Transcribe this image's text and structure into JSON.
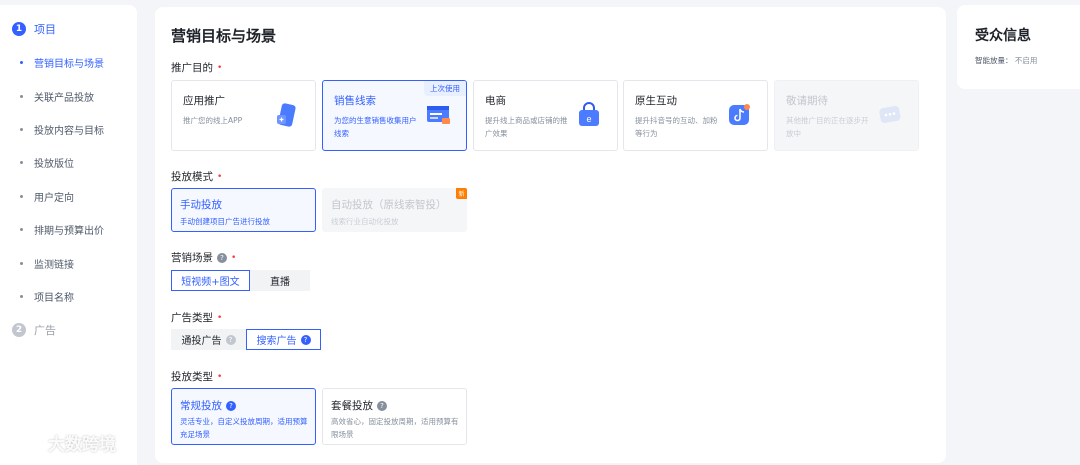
{
  "sidebar": {
    "step1": {
      "num": "1",
      "label": "项目"
    },
    "items": [
      {
        "label": "营销目标与场景"
      },
      {
        "label": "关联产品投放"
      },
      {
        "label": "投放内容与目标"
      },
      {
        "label": "投放版位"
      },
      {
        "label": "用户定向"
      },
      {
        "label": "排期与预算出价"
      },
      {
        "label": "监测链接"
      },
      {
        "label": "项目名称"
      }
    ],
    "step2": {
      "num": "2",
      "label": "广告"
    }
  },
  "main": {
    "title": "营销目标与场景",
    "purpose": {
      "label": "推广目的",
      "cards": [
        {
          "title": "应用推广",
          "desc": "推广您的线上APP"
        },
        {
          "title": "销售线索",
          "desc": "为您的生意销售收集用户线索",
          "badge": "上次使用"
        },
        {
          "title": "电商",
          "desc": "提升线上商品或店铺的推广效果"
        },
        {
          "title": "原生互动",
          "desc": "提升抖音号的互动、加粉等行为"
        },
        {
          "title": "敬请期待",
          "desc": "其他推广目的正在逐步开放中"
        }
      ]
    },
    "mode": {
      "label": "投放模式",
      "cards": [
        {
          "title": "手动投放",
          "desc": "手动创建项目广告进行投放"
        },
        {
          "title": "自动投放（原线索智投）",
          "desc": "线索行业自动化投放",
          "tag": "新"
        }
      ]
    },
    "scene": {
      "label": "营销场景",
      "help": "?",
      "options": [
        "短视频+图文",
        "直播"
      ]
    },
    "ad_type": {
      "label": "广告类型",
      "options": [
        {
          "label": "通投广告",
          "help": "?"
        },
        {
          "label": "搜索广告",
          "help": "?"
        }
      ]
    },
    "delivery_type": {
      "label": "投放类型",
      "cards": [
        {
          "title": "常规投放",
          "help": "?",
          "desc": "灵活专业，自定义投放周期，适用预算充足场景"
        },
        {
          "title": "套餐投放",
          "help": "?",
          "desc": "高效省心，固定投放周期，适用预算有限场景"
        }
      ]
    },
    "required_mark": "•"
  },
  "audience": {
    "title": "受众信息",
    "row_label": "智能放量：",
    "row_value": "不启用"
  },
  "watermark": {
    "text": "大数跨境"
  },
  "colors": {
    "accent": "#3360ff",
    "required": "#f53f3f",
    "new_tag": "#ff7d00"
  }
}
